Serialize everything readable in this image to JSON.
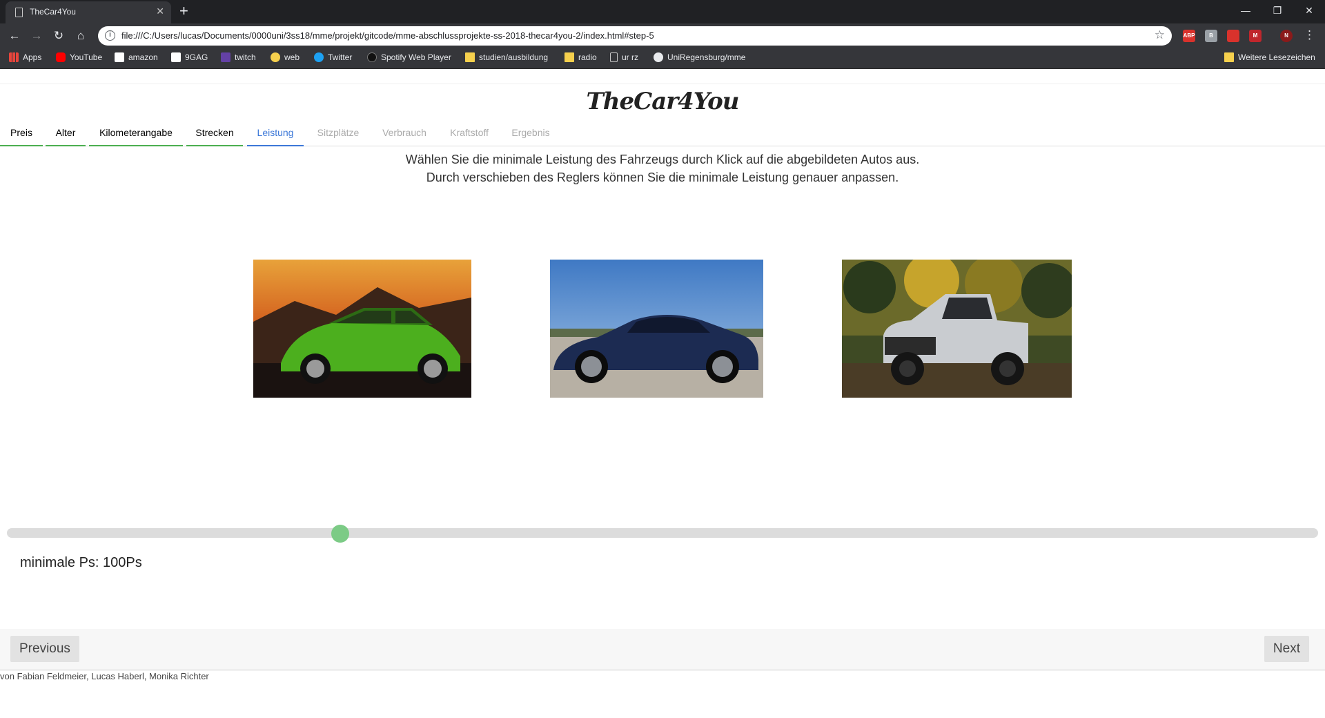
{
  "browser": {
    "tab_title": "TheCar4You",
    "url": "file:///C:/Users/lucas/Documents/0000uni/3ss18/mme/projekt/gitcode/mme-abschlussprojekte-ss-2018-thecar4you-2/index.html#step-5",
    "bookmarks": [
      "Apps",
      "YouTube",
      "amazon",
      "9GAG",
      "twitch",
      "web",
      "Twitter",
      "Spotify Web Player",
      "studien/ausbildung",
      "radio",
      "ur rz",
      "UniRegensburg/mme"
    ],
    "other_bookmarks": "Weitere Lesezeichen",
    "extensions": [
      "ABP",
      "B",
      "",
      "M",
      "N"
    ]
  },
  "site": {
    "logo": "TheCar4You"
  },
  "steps": [
    {
      "label": "Preis",
      "state": "done"
    },
    {
      "label": "Alter",
      "state": "done"
    },
    {
      "label": "Kilometerangabe",
      "state": "done"
    },
    {
      "label": "Strecken",
      "state": "done"
    },
    {
      "label": "Leistung",
      "state": "active"
    },
    {
      "label": "Sitzplätze",
      "state": "todo"
    },
    {
      "label": "Verbrauch",
      "state": "todo"
    },
    {
      "label": "Kraftstoff",
      "state": "todo"
    },
    {
      "label": "Ergebnis",
      "state": "todo"
    }
  ],
  "instruction": {
    "line1": "Wählen Sie die minimale Leistung des Fahrzeugs durch Klick auf die abgebildeten Autos aus.",
    "line2": "Durch verschieben des Reglers können Sie die minimale Leistung genauer anpassen."
  },
  "cars": [
    {
      "name": "green-hatchback",
      "color": "#4caf1e"
    },
    {
      "name": "blue-coupe",
      "color": "#1c2b52"
    },
    {
      "name": "silver-pickup",
      "color": "#c9ccd0"
    }
  ],
  "slider": {
    "label": "minimale Ps: 100Ps",
    "fraction": 0.254
  },
  "pager": {
    "previous": "Previous",
    "next": "Next"
  },
  "footer": "von Fabian Feldmeier, Lucas Haberl, Monika Richter"
}
